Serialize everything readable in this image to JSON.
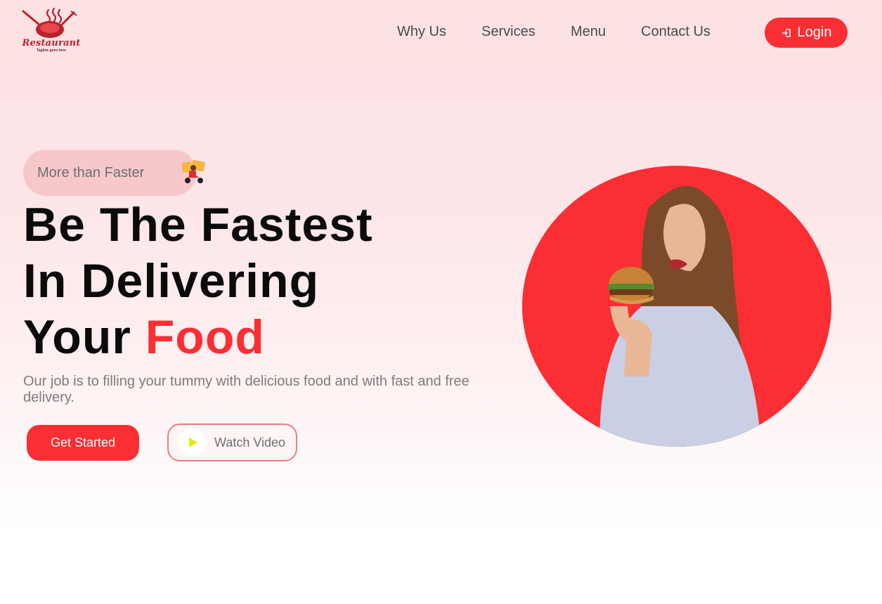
{
  "brand": {
    "name": "Restaurant",
    "tagline": "Tagline goes here"
  },
  "nav": {
    "items": [
      "Why Us",
      "Services",
      "Menu",
      "Contact Us"
    ]
  },
  "login": {
    "label": "Login"
  },
  "badge": {
    "label": "More than Faster",
    "icon": "delivery-scooter-icon"
  },
  "headline": {
    "line1": "Be The Fastest",
    "line2": "In Delivering",
    "line3_prefix": "Your",
    "line3_highlight": "Food"
  },
  "description": "Our job is to filling your tummy with delicious food and with fast and free delivery.",
  "cta": {
    "primary": "Get Started",
    "secondary": "Watch Video"
  },
  "hero": {
    "image": "woman-eating-burger"
  },
  "colors": {
    "accent": "#fb2e33",
    "text": "#0b0b0b",
    "muted": "#7c7c7c",
    "play": "#e0ee0a"
  }
}
